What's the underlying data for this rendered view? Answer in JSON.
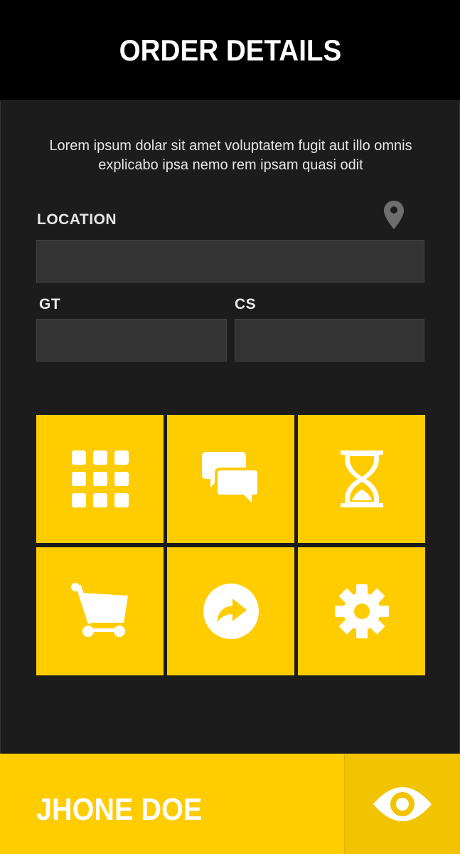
{
  "header": {
    "title": "ORDER DETAILS"
  },
  "description": "Lorem ipsum dolar sit amet voluptatem fugit aut illo omnis explicabo ipsa nemo rem ipsam quasi odit",
  "form": {
    "location_label": "LOCATION",
    "location_value": "",
    "gt_label": "GT",
    "gt_value": "",
    "cs_label": "CS",
    "cs_value": ""
  },
  "tiles": [
    {
      "icon": "grid-icon"
    },
    {
      "icon": "chat-icon"
    },
    {
      "icon": "hourglass-icon"
    },
    {
      "icon": "cart-icon"
    },
    {
      "icon": "share-arrow-icon"
    },
    {
      "icon": "gear-icon"
    }
  ],
  "footer": {
    "user_name": "JHONE DOE",
    "action_icon": "eye-icon"
  },
  "colors": {
    "accent": "#ffcc00",
    "background": "#1c1c1c",
    "header": "#000000",
    "field": "#333333",
    "icon_muted": "#6e6e6e"
  }
}
